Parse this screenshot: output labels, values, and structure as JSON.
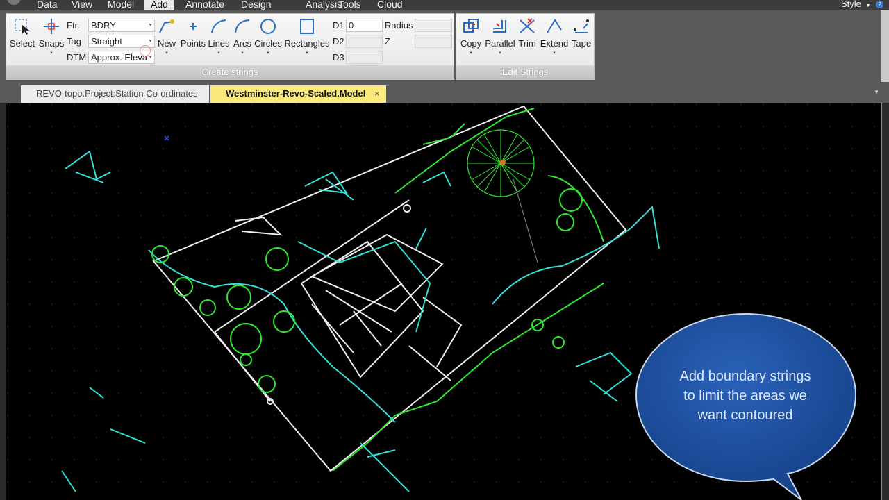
{
  "menu": {
    "items": [
      "Data",
      "View",
      "Model",
      "Add",
      "Annotate",
      "Design",
      "Analysis",
      "Tools",
      "Cloud"
    ],
    "active": "Add",
    "style_label": "Style"
  },
  "ribbon": {
    "create_group": {
      "title": "Create strings",
      "select_label": "Select",
      "snaps_label": "Snaps",
      "ftr_label": "Ftr.",
      "ftr_value": "BDRY",
      "tag_label": "Tag",
      "tag_value": "Straight",
      "dtm_label": "DTM",
      "dtm_value": "Approx. Eleva",
      "new_label": "New",
      "points_label": "Points",
      "lines_label": "Lines",
      "arcs_label": "Arcs",
      "circles_label": "Circles",
      "rectangles_label": "Rectangles",
      "d1_label": "D1",
      "d1_value": "0",
      "d2_label": "D2",
      "d3_label": "D3",
      "radius_label": "Radius",
      "z_label": "Z"
    },
    "edit_group": {
      "title": "Edit Strings",
      "copy_label": "Copy",
      "parallel_label": "Parallel",
      "trim_label": "Trim",
      "extend_label": "Extend",
      "tape_label": "Tape"
    }
  },
  "tabs": {
    "inactive": "REVO-topo.Project:Station Co-ordinates",
    "active": "Westminster-Revo-Scaled.Model",
    "close_glyph": "×"
  },
  "callout": {
    "line1": "Add boundary strings",
    "line2": "to limit the areas we",
    "line3": "want contoured"
  },
  "colors": {
    "canvas_bg": "#000000",
    "cyan_strings": "#33e0d8",
    "green_strings": "#2ee82e",
    "white_strings": "#f2f2f2",
    "callout_fill": "#1f4f9c",
    "active_tab": "#fbe97c"
  }
}
